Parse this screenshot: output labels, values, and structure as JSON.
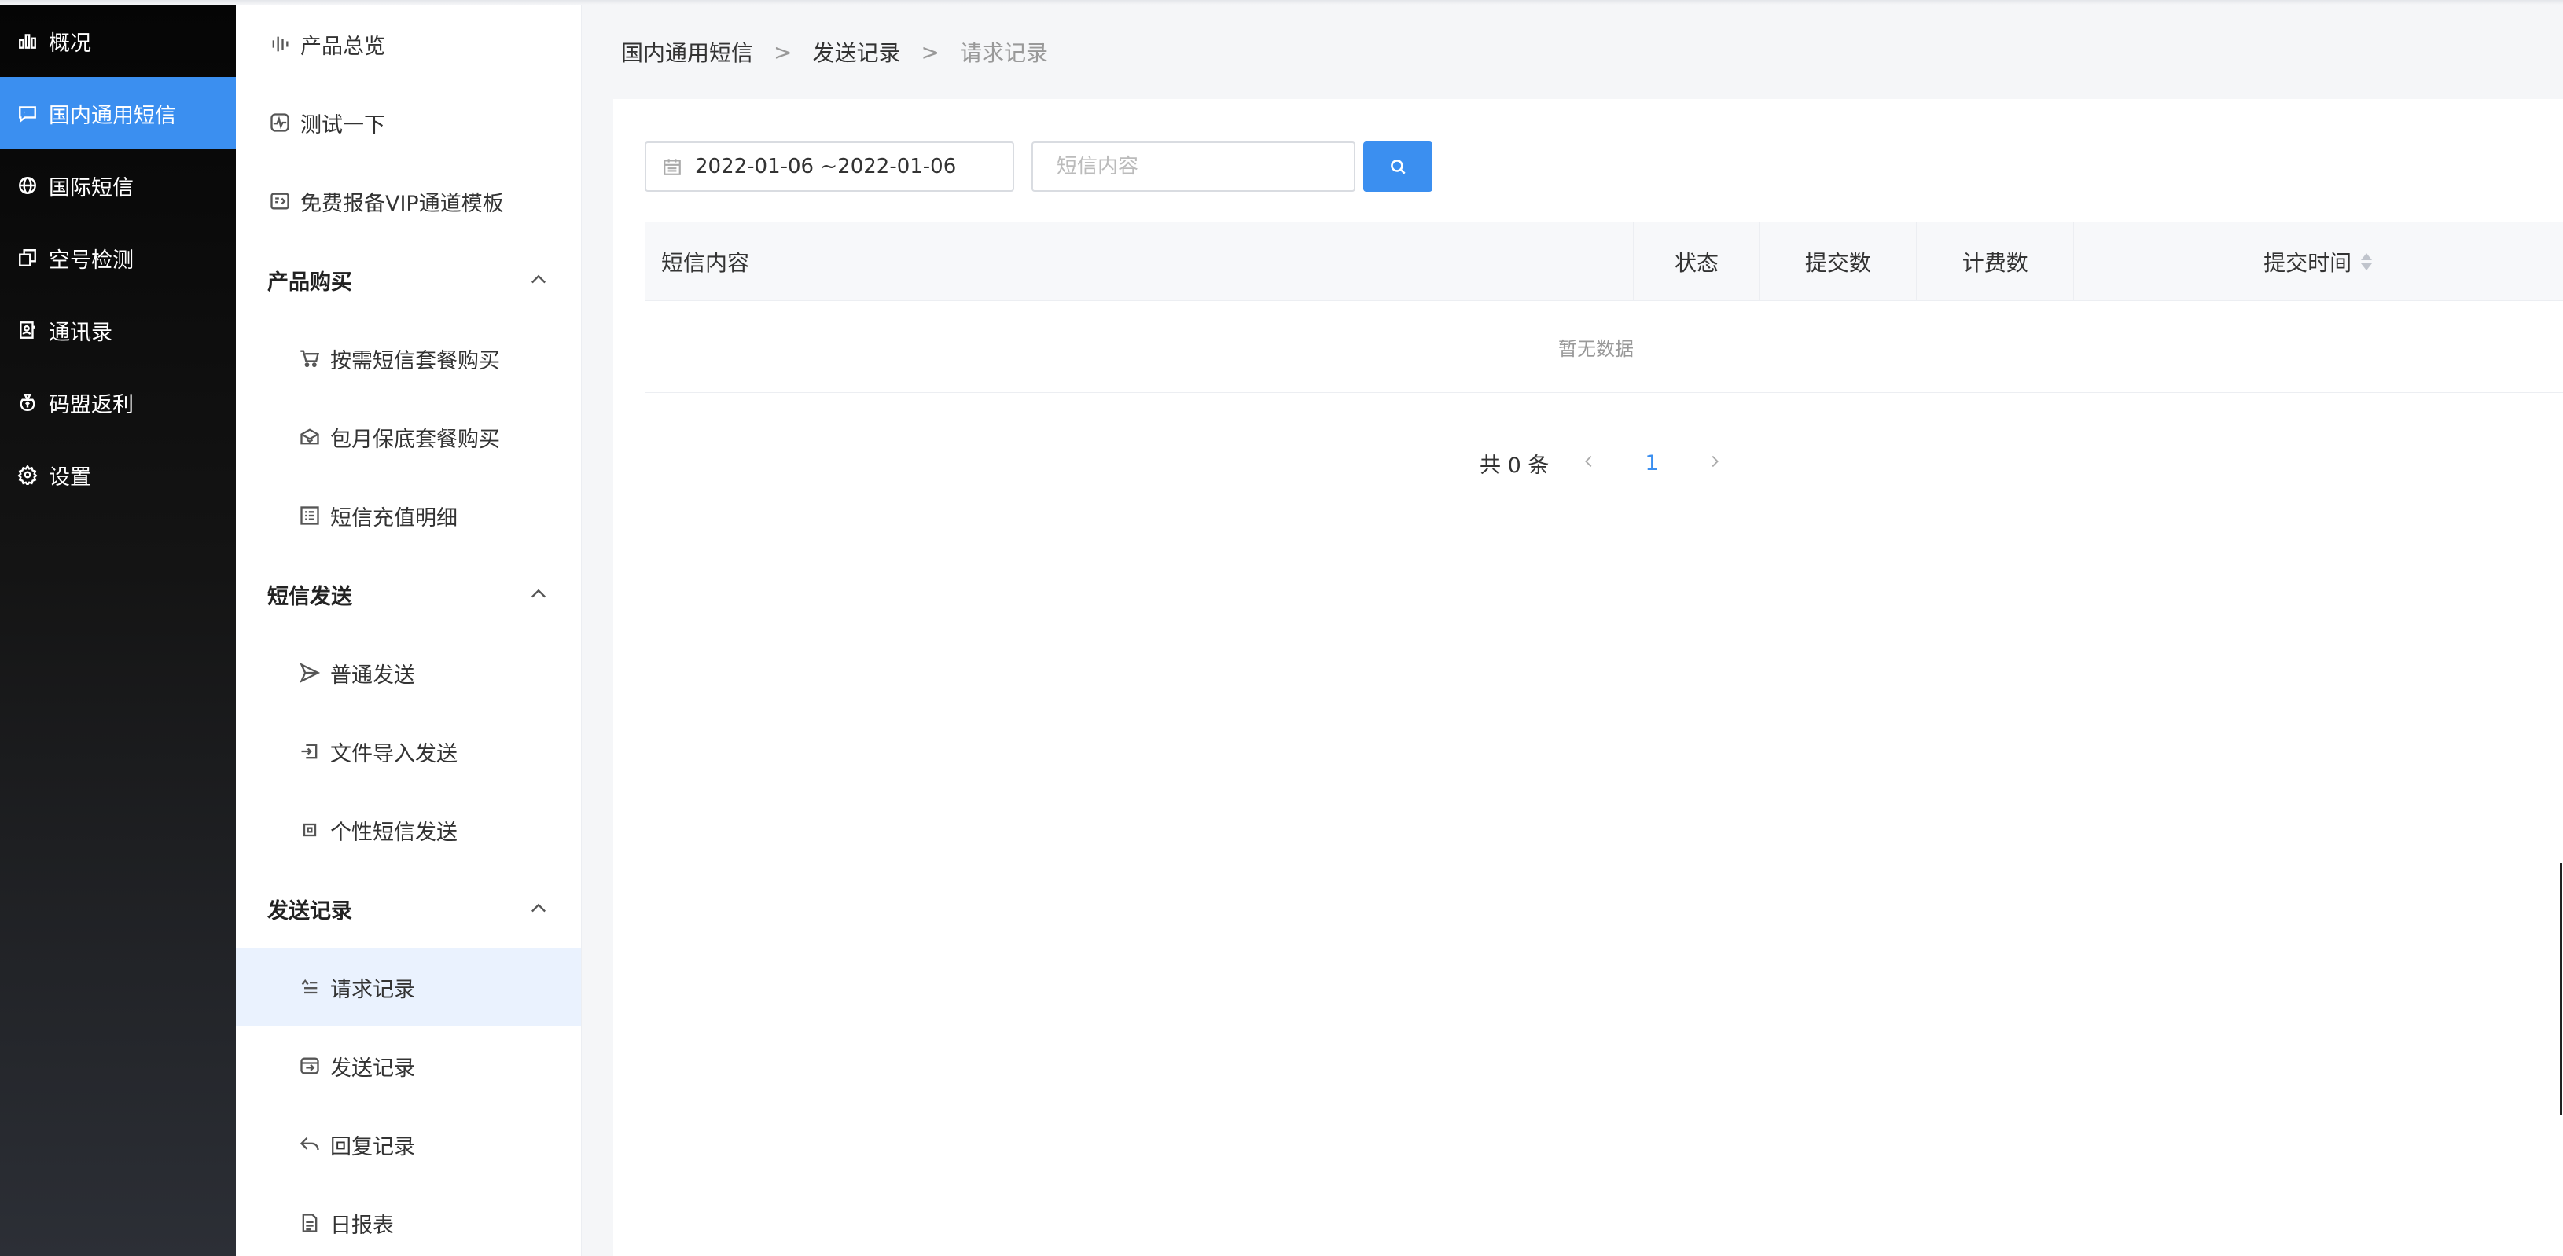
{
  "sidebar": {
    "items": [
      {
        "label": "概况",
        "icon": "bar-chart-icon"
      },
      {
        "label": "国内通用短信",
        "icon": "message-icon",
        "active": true
      },
      {
        "label": "国际短信",
        "icon": "globe-icon"
      },
      {
        "label": "空号检测",
        "icon": "detect-icon"
      },
      {
        "label": "通讯录",
        "icon": "contacts-icon"
      },
      {
        "label": "码盟返利",
        "icon": "money-bag-icon"
      },
      {
        "label": "设置",
        "icon": "gear-icon"
      }
    ]
  },
  "submenu": {
    "items": [
      {
        "label": "产品总览",
        "icon": "overview-icon"
      },
      {
        "label": "测试一下",
        "icon": "pulse-icon"
      },
      {
        "label": "免费报备VIP通道模板",
        "icon": "vip-template-icon"
      }
    ],
    "groups": [
      {
        "title": "产品购买",
        "children": [
          {
            "label": "按需短信套餐购买",
            "icon": "cart-icon"
          },
          {
            "label": "包月保底套餐购买",
            "icon": "package-icon"
          },
          {
            "label": "短信充值明细",
            "icon": "list-icon"
          }
        ]
      },
      {
        "title": "短信发送",
        "children": [
          {
            "label": "普通发送",
            "icon": "send-icon"
          },
          {
            "label": "文件导入发送",
            "icon": "import-icon"
          },
          {
            "label": "个性短信发送",
            "icon": "custom-icon"
          }
        ]
      },
      {
        "title": "发送记录",
        "children": [
          {
            "label": "请求记录",
            "icon": "request-icon",
            "active": true
          },
          {
            "label": "发送记录",
            "icon": "send-record-icon"
          },
          {
            "label": "回复记录",
            "icon": "reply-icon"
          },
          {
            "label": "日报表",
            "icon": "report-icon"
          }
        ]
      }
    ]
  },
  "breadcrumb": {
    "items": [
      "国内通用短信",
      "发送记录",
      "请求记录"
    ],
    "separator": ">"
  },
  "filters": {
    "date_range": "2022-01-06  ~2022-01-06",
    "search_placeholder": "短信内容",
    "search_value": ""
  },
  "table": {
    "columns": [
      "短信内容",
      "状态",
      "提交数",
      "计费数",
      "提交时间"
    ],
    "empty_text": "暂无数据"
  },
  "pagination": {
    "total_text": "共 0 条",
    "current_page": "1"
  },
  "colors": {
    "accent": "#3b8ff0",
    "sidebar_bg": "#050505",
    "active_row": "#eaf2fe"
  }
}
